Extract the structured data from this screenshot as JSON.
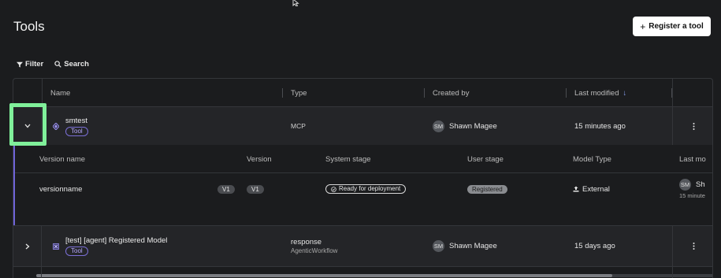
{
  "page": {
    "title": "Tools"
  },
  "header": {
    "register_label": "Register a tool",
    "plus": "+"
  },
  "toolbar": {
    "filter_label": "Filter",
    "search_label": "Search"
  },
  "table": {
    "columns": {
      "name": "Name",
      "type": "Type",
      "created_by": "Created by",
      "last_modified": "Last modified",
      "sort_indicator": "↓"
    },
    "rows": [
      {
        "name": "smtest",
        "tag": "Tool",
        "type": "MCP",
        "type_sub": "",
        "creator_initials": "SM",
        "creator": "Shawn Magee",
        "modified": "15 minutes ago"
      },
      {
        "name": "[test] [agent] Registered Model",
        "tag": "Tool",
        "type": "response",
        "type_sub": "AgenticWorkflow",
        "creator_initials": "SM",
        "creator": "Shawn Magee",
        "modified": "15 days ago"
      }
    ]
  },
  "versions": {
    "columns": {
      "version_name": "Version name",
      "version": "Version",
      "system_stage": "System stage",
      "user_stage": "User stage",
      "model_type": "Model Type",
      "last_mod": "Last mo"
    },
    "rows": [
      {
        "version_name": "versionname",
        "v_badge": "V1",
        "version": "V1",
        "system_stage": "Ready for deployment",
        "user_stage": "Registered",
        "model_type": "External",
        "last_initials": "SM",
        "last_name": "Sh",
        "last_time": "15 minute"
      }
    ],
    "scroll_fraction": 0.85
  }
}
